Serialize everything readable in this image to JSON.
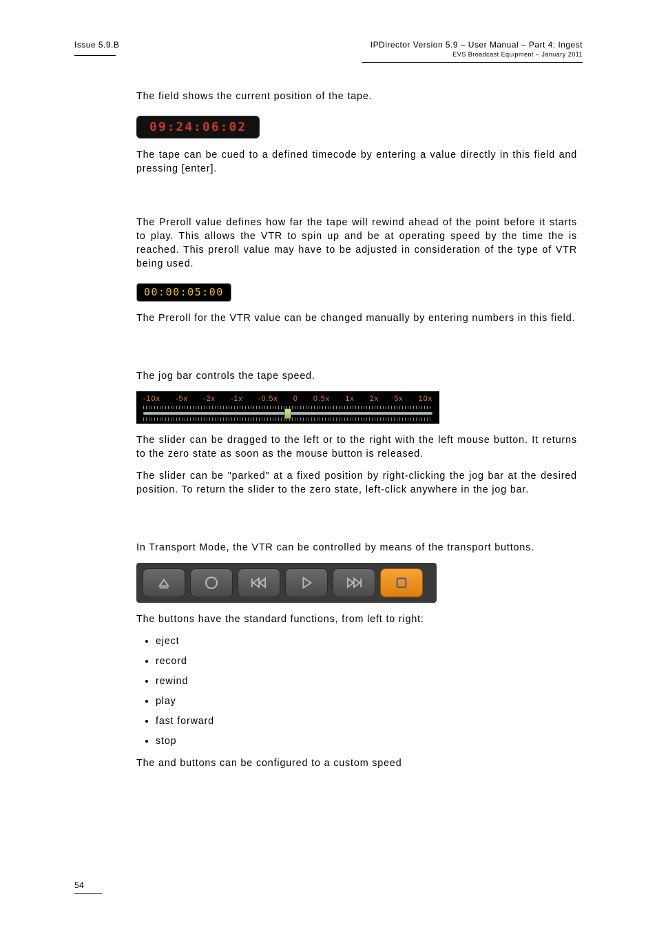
{
  "header": {
    "issue": "Issue 5.9.B",
    "title": "IPDirector Version 5.9 – User Manual – Part 4: Ingest",
    "subtitle": "EVS Broadcast Equipment – January 2011"
  },
  "goto": {
    "p1_a": "The ",
    "p1_b": " field shows the current position of the tape.",
    "tc_value": "09:24:06:02",
    "p2": "The tape can be cued to a defined timecode by entering a value directly in this field and pressing [enter]."
  },
  "preroll": {
    "p1_a": "The Preroll value defines how far the tape will rewind ahead of the ",
    "p1_b": " point before it starts to play.  This allows the VTR to spin up and be at operating speed by the time the ",
    "p1_c": " is reached. This preroll value may have to be adjusted in consideration of the type of VTR being used.",
    "value": "00:00:05:00",
    "p2": "The Preroll for the VTR value can be changed manually by entering numbers in this field."
  },
  "jog": {
    "p1": "The jog bar controls the tape speed.",
    "labels": [
      "-10x",
      "-5x",
      "-2x",
      "-1x",
      "-0.5x",
      "0",
      "0.5x",
      "1x",
      "2x",
      "5x",
      "10x"
    ],
    "p2": "The slider can be dragged to the left or to the right with the left mouse button.  It returns to the zero state as soon as the mouse button is released.",
    "p3": "The slider can be \"parked\" at a fixed position by right-clicking the jog bar at the desired position. To return the slider to the zero state, left-click anywhere in the jog bar."
  },
  "transport": {
    "p1": "In Transport Mode, the VTR can be controlled by means of the transport buttons.",
    "p2": "The buttons have the standard functions, from left to right:",
    "functions": [
      "eject",
      "record",
      "rewind",
      "play",
      "fast forward",
      "stop"
    ],
    "p3_a": "The ",
    "p3_b": " and ",
    "p3_c": " buttons can be configured to a custom speed"
  },
  "page_number": "54"
}
